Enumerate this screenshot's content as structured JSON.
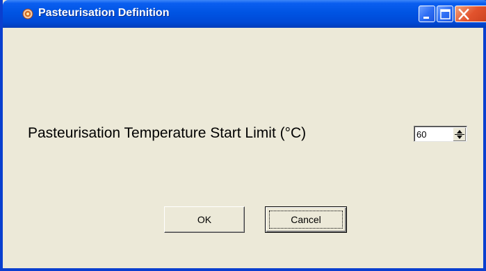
{
  "window": {
    "title": "Pasteurisation Definition",
    "controls": [
      "minimize-icon",
      "maximize-icon",
      "close-icon"
    ]
  },
  "form": {
    "label": "Pasteurisation Temperature Start Limit (°C)",
    "value": "60"
  },
  "buttons": {
    "ok_label": "OK",
    "cancel_label": "Cancel"
  },
  "colors": {
    "titlebar": "#0054e3",
    "dialog_bg": "#ece9d8",
    "close_button": "#e2532d"
  }
}
